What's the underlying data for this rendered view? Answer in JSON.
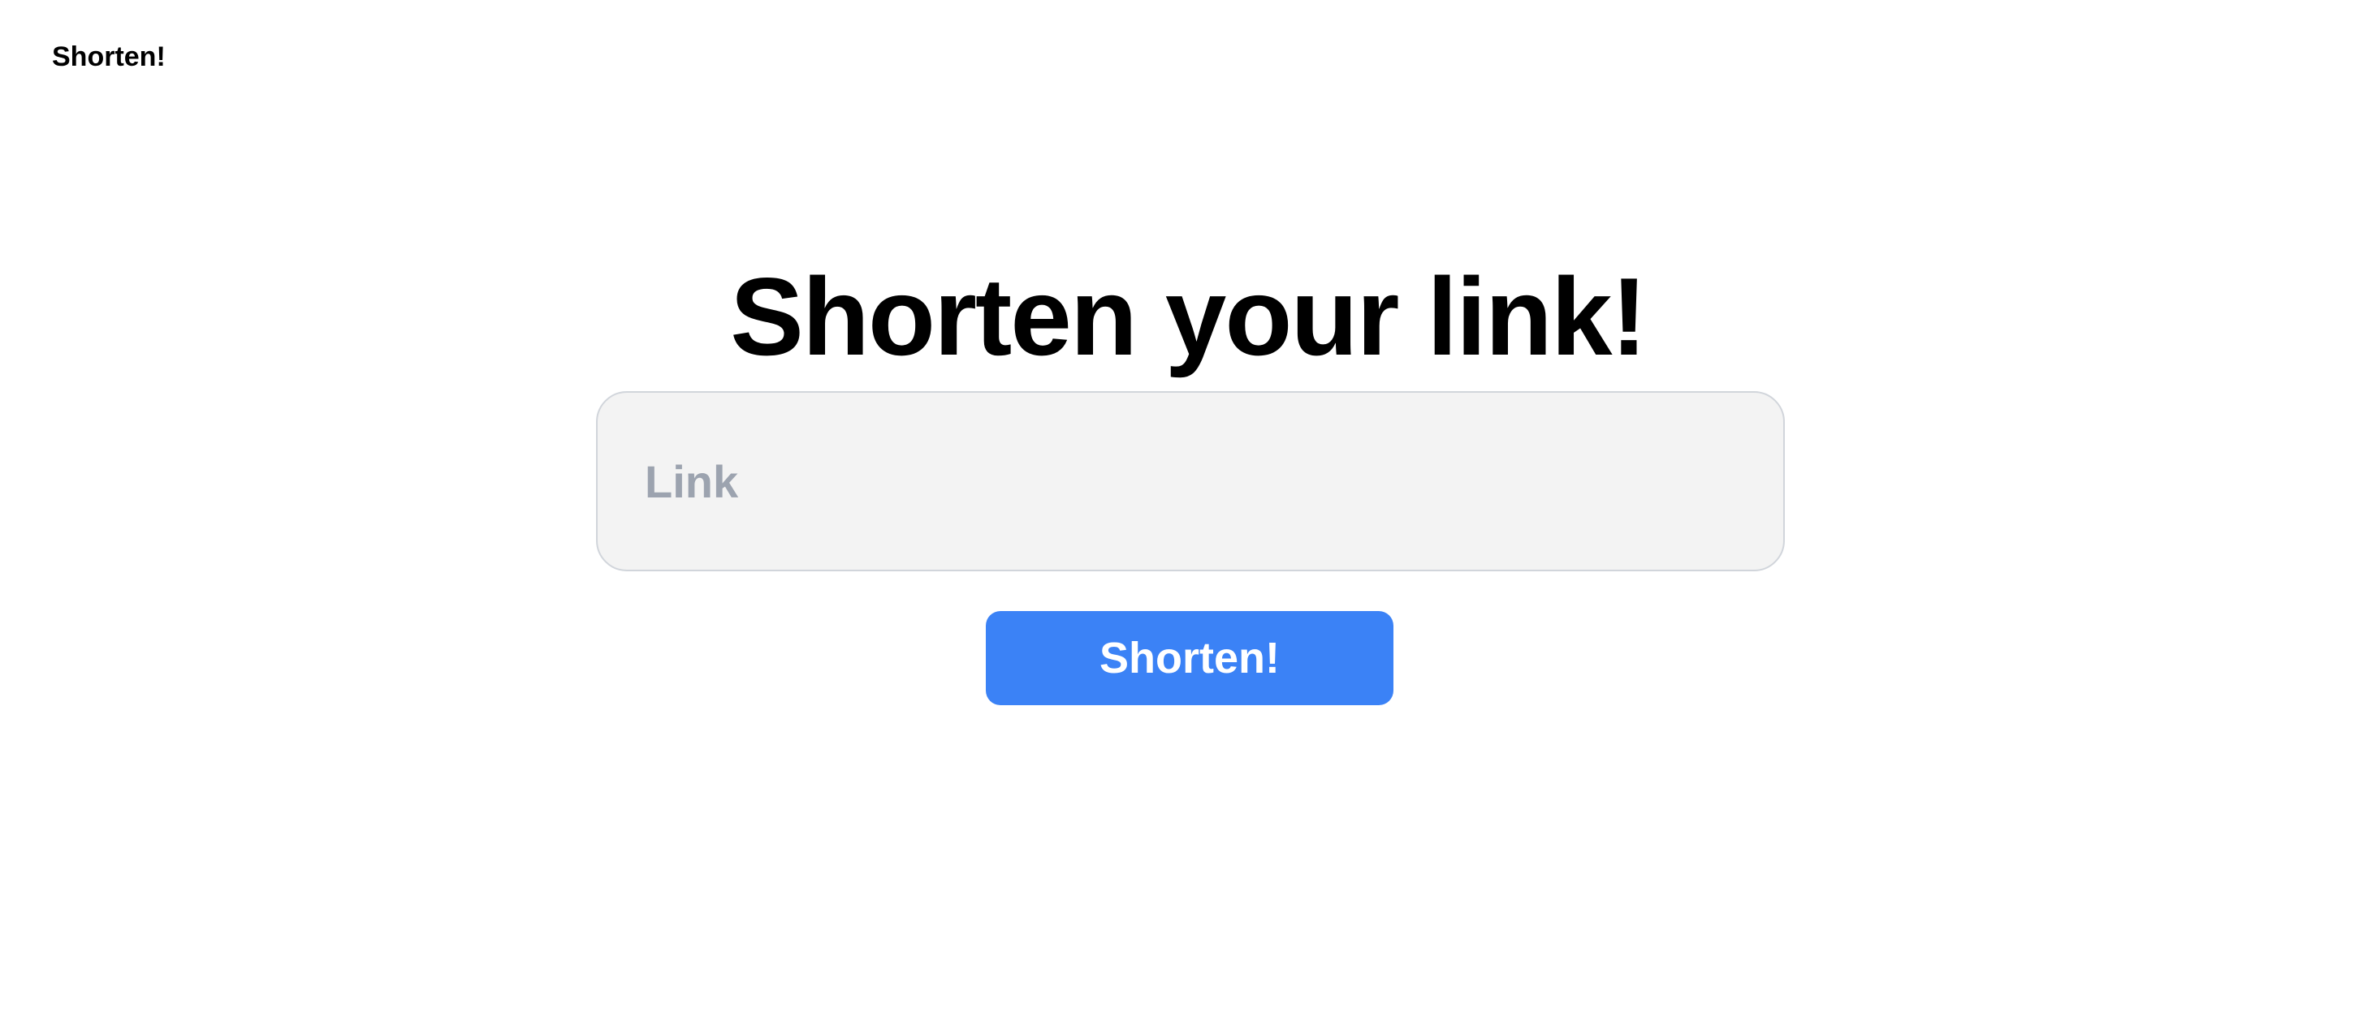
{
  "header": {
    "brand_label": "Shorten!"
  },
  "main": {
    "title": "Shorten your link!",
    "link_input": {
      "value": "",
      "placeholder": "Link"
    },
    "shorten_button_label": "Shorten!"
  },
  "colors": {
    "background": "#ffffff",
    "input_background": "#f3f3f3",
    "input_border": "#d1d5db",
    "placeholder": "#9ca3af",
    "button_background": "#3b82f6",
    "button_text": "#ffffff",
    "text": "#000000"
  }
}
